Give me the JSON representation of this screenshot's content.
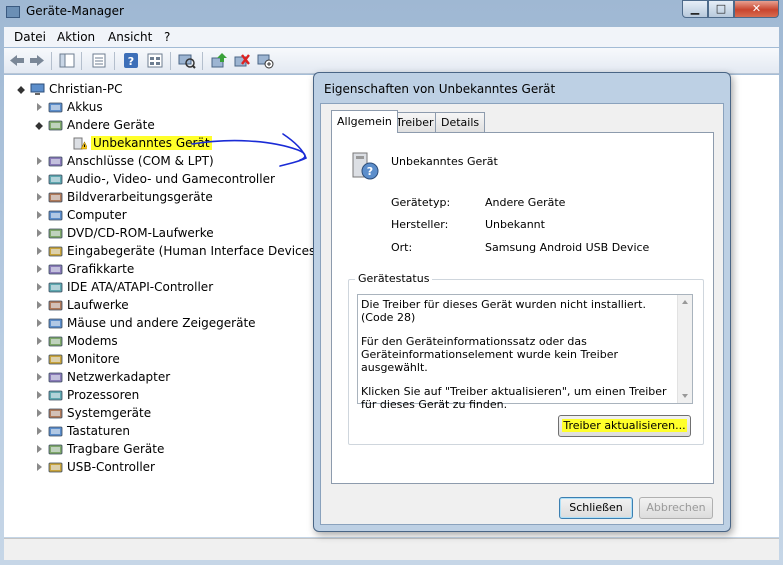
{
  "window": {
    "title": "Geräte-Manager",
    "min_label": "▁",
    "max_label": "□",
    "close_label": "✕"
  },
  "menu": {
    "items": [
      "Datei",
      "Aktion",
      "Ansicht",
      "?"
    ]
  },
  "tree": {
    "root": "Christian-PC",
    "nodes": [
      {
        "label": "Akkus",
        "icon": "battery-icon"
      },
      {
        "label": "Andere Geräte",
        "icon": "other-devices-icon",
        "expanded": true
      },
      {
        "label": "Unbekanntes Gerät",
        "icon": "unknown-device-warning-icon",
        "highlight": true
      },
      {
        "label": "Anschlüsse (COM & LPT)",
        "icon": "port-icon"
      },
      {
        "label": "Audio-, Video- und Gamecontroller",
        "icon": "audio-icon"
      },
      {
        "label": "Bildverarbeitungsgeräte",
        "icon": "camera-icon"
      },
      {
        "label": "Computer",
        "icon": "computer-icon"
      },
      {
        "label": "DVD/CD-ROM-Laufwerke",
        "icon": "dvd-icon"
      },
      {
        "label": "Eingabegeräte (Human Interface Devices)",
        "icon": "hid-icon"
      },
      {
        "label": "Grafikkarte",
        "icon": "display-adapter-icon"
      },
      {
        "label": "IDE ATA/ATAPI-Controller",
        "icon": "ide-icon"
      },
      {
        "label": "Laufwerke",
        "icon": "disk-icon"
      },
      {
        "label": "Mäuse und andere Zeigegeräte",
        "icon": "mouse-icon"
      },
      {
        "label": "Modems",
        "icon": "modem-icon"
      },
      {
        "label": "Monitore",
        "icon": "monitor-icon"
      },
      {
        "label": "Netzwerkadapter",
        "icon": "network-icon"
      },
      {
        "label": "Prozessoren",
        "icon": "cpu-icon"
      },
      {
        "label": "Systemgeräte",
        "icon": "system-icon"
      },
      {
        "label": "Tastaturen",
        "icon": "keyboard-icon"
      },
      {
        "label": "Tragbare Geräte",
        "icon": "portable-device-icon"
      },
      {
        "label": "USB-Controller",
        "icon": "usb-icon"
      }
    ]
  },
  "dialog": {
    "title": "Eigenschaften von Unbekanntes Gerät",
    "tabs": [
      "Allgemein",
      "Treiber",
      "Details"
    ],
    "device_name": "Unbekanntes Gerät",
    "props": [
      {
        "label": "Gerätetyp:",
        "value": "Andere Geräte"
      },
      {
        "label": "Hersteller:",
        "value": "Unbekannt"
      },
      {
        "label": "Ort:",
        "value": "Samsung Android USB Device"
      }
    ],
    "status_group_label": "Gerätestatus",
    "status_paragraphs": [
      "Die Treiber für dieses Gerät wurden nicht installiert. (Code 28)",
      "Für den Geräteinformationssatz oder das Geräteinformationselement wurde kein Treiber ausgewählt.",
      "Klicken Sie auf \"Treiber aktualisieren\", um einen Treiber für dieses Gerät zu finden."
    ],
    "update_button": "Treiber aktualisieren...",
    "close_button": "Schließen",
    "cancel_button": "Abbrechen"
  },
  "colors": {
    "highlight": "#ffff2a",
    "annotation_arrow": "#1a2bd6",
    "window_chrome": "#b9cde2"
  }
}
